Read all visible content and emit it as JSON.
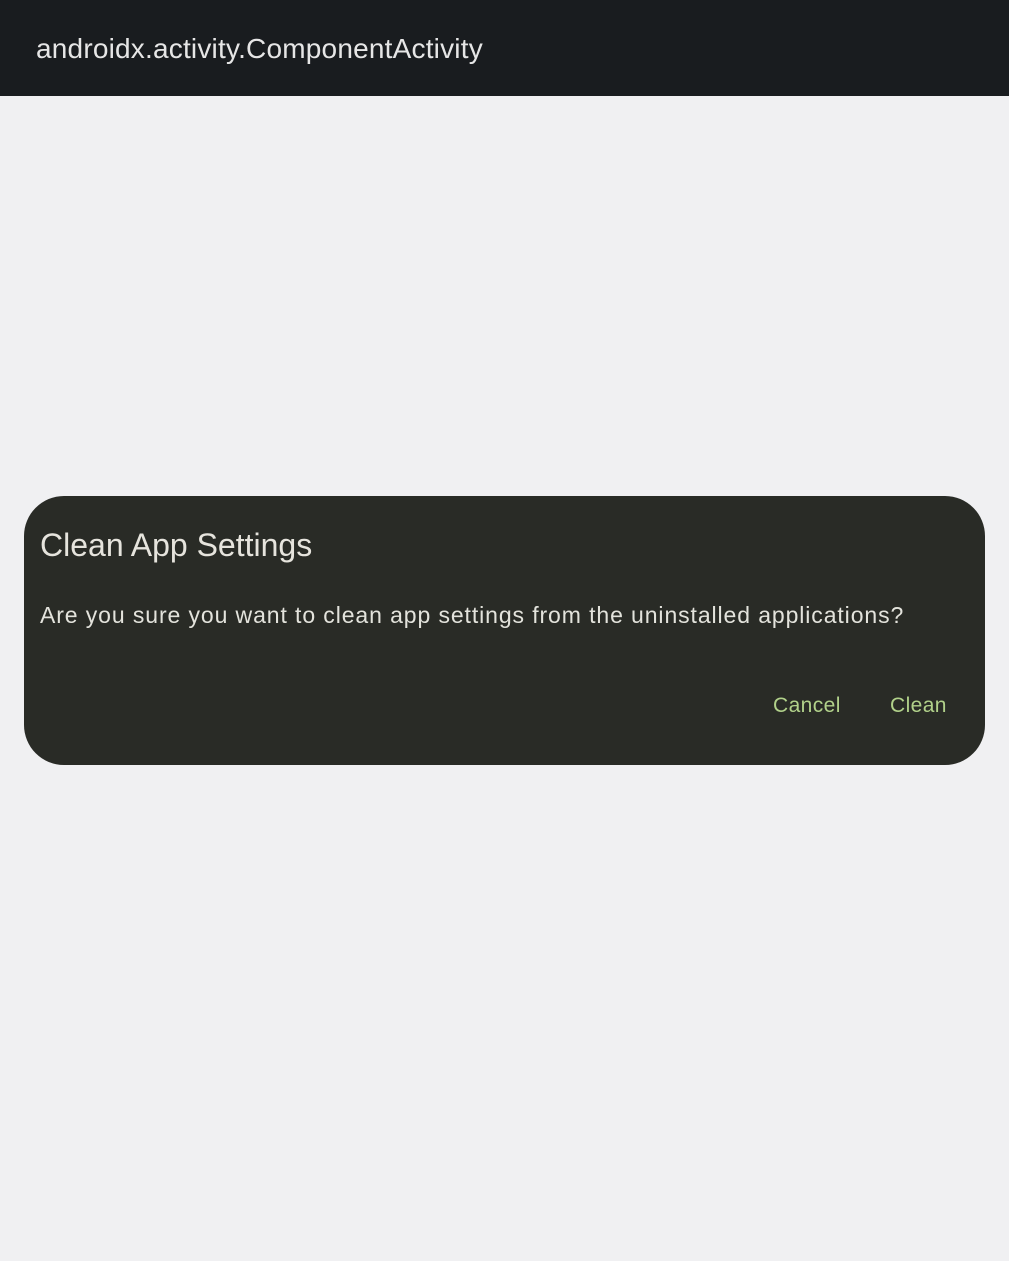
{
  "app_bar": {
    "title": "androidx.activity.ComponentActivity"
  },
  "dialog": {
    "title": "Clean App Settings",
    "message": "Are you sure you want to clean app settings from the uninstalled applications?",
    "buttons": {
      "cancel_label": "Cancel",
      "confirm_label": "Clean"
    }
  },
  "colors": {
    "app_bar_background": "#191c1f",
    "page_background": "#f0f0f2",
    "dialog_background": "#292b26",
    "dialog_text": "#e6e4dd",
    "button_text": "#b1d18a"
  }
}
